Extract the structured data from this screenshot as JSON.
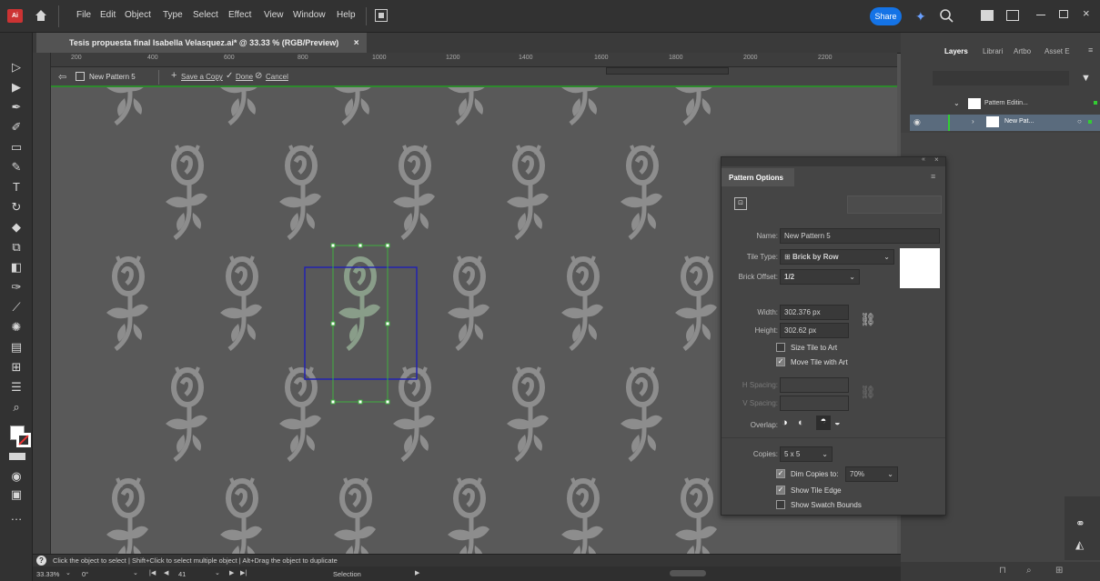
{
  "app": {
    "logo": "Ai",
    "menus": [
      "File",
      "Edit",
      "Object",
      "Type",
      "Select",
      "Effect",
      "View",
      "Window",
      "Help"
    ],
    "share_label": "Share"
  },
  "document": {
    "tab_title": "Tesis propuesta final Isabella Velasquez.ai* @ 33.33 % (RGB/Preview)",
    "close": "×"
  },
  "rulers": {
    "h_ticks": [
      "200",
      "400",
      "600",
      "800",
      "1000",
      "1200",
      "1400",
      "1600",
      "1800",
      "2000",
      "2200"
    ]
  },
  "pattern_bar": {
    "name": "New Pattern 5",
    "save_copy": "Save a Copy",
    "done": "Done",
    "cancel": "Cancel"
  },
  "status": {
    "hint": "Click the object to select  |  Shift+Click to select multiple object  |  Alt+Drag the object to duplicate"
  },
  "bottom": {
    "zoom": "33.33%",
    "rotation": "0°",
    "artboard": "41",
    "mode": "Selection"
  },
  "layers_panel": {
    "tabs": [
      "Layers",
      "Librari",
      "Artbo",
      "Asset E"
    ],
    "items": [
      {
        "label": "Pattern Editin..."
      },
      {
        "label": "New Pat..."
      }
    ]
  },
  "pattern_options": {
    "title": "Pattern Options",
    "name_label": "Name:",
    "name_value": "New Pattern 5",
    "tile_type_label": "Tile Type:",
    "tile_type_value": "Brick by Row",
    "brick_offset_label": "Brick Offset:",
    "brick_offset_value": "1/2",
    "width_label": "Width:",
    "width_value": "302.376 px",
    "height_label": "Height:",
    "height_value": "302.62 px",
    "size_tile_label": "Size Tile to Art",
    "move_tile_label": "Move Tile with Art",
    "h_spacing_label": "H Spacing:",
    "v_spacing_label": "V Spacing:",
    "overlap_label": "Overlap:",
    "copies_label": "Copies:",
    "copies_value": "5 x 5",
    "dim_copies_label": "Dim Copies to:",
    "dim_copies_value": "70%",
    "show_tile_edge_label": "Show Tile Edge",
    "show_swatch_bounds_label": "Show Swatch Bounds",
    "size_tile_checked": false,
    "move_tile_checked": true,
    "dim_copies_checked": true,
    "show_tile_edge_checked": true,
    "show_swatch_bounds_checked": false
  },
  "colors": {
    "accent": "#1473e6",
    "pattern_edit_line": "#2d8a2d",
    "tile_box": "#1a1aa8",
    "motif": "#909090",
    "selected_motif": "#8a9e8a"
  }
}
